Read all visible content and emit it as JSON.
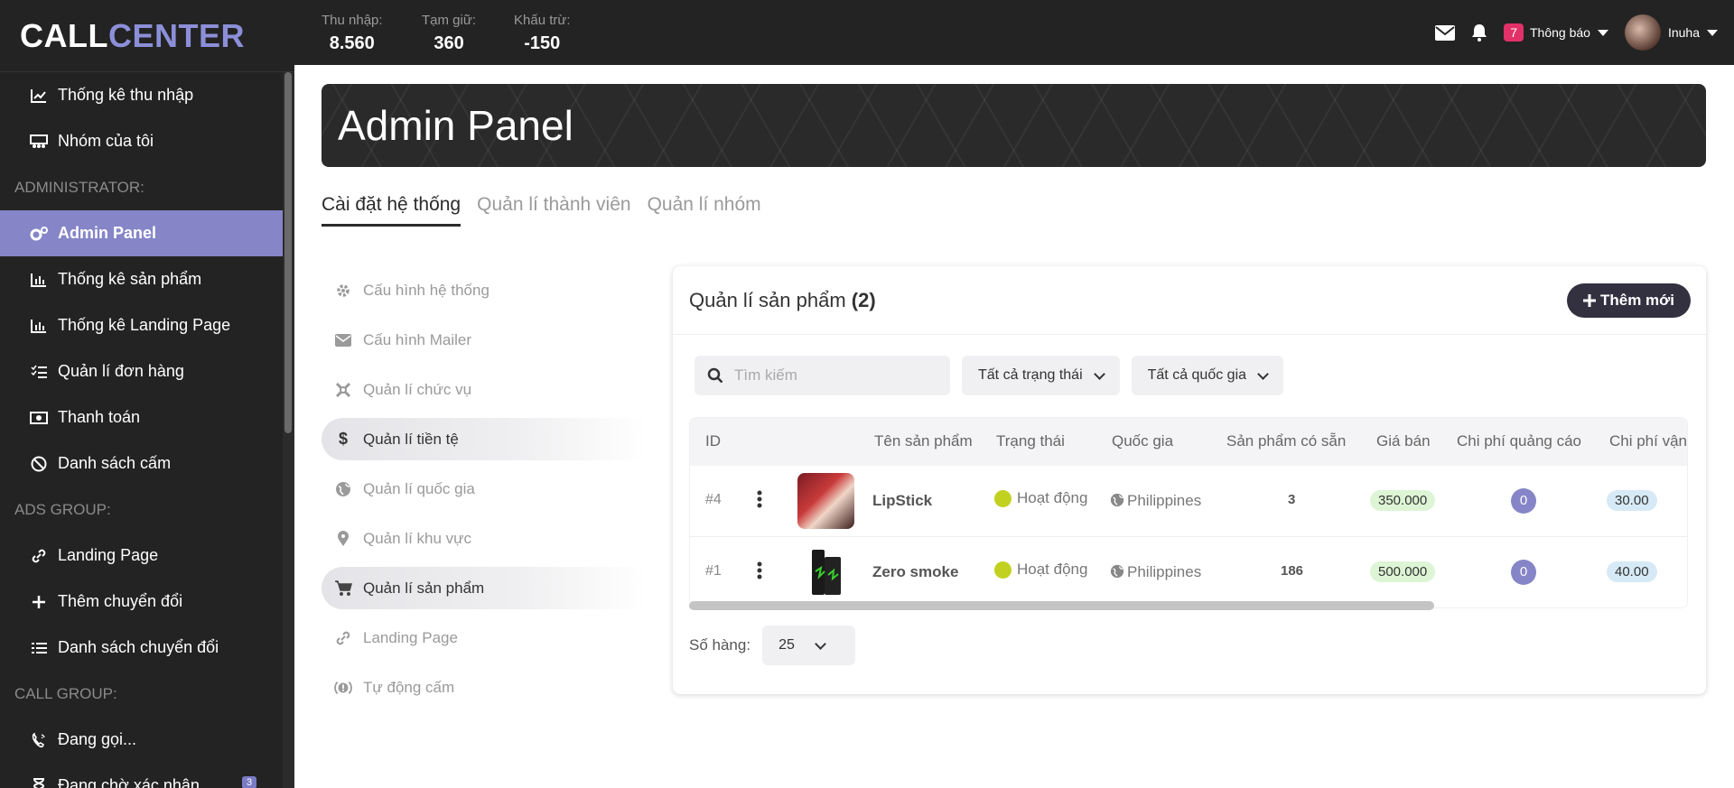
{
  "app": {
    "logo_part1": "CALL",
    "logo_part2": "CENTER",
    "logo_color": "#8c8fd8"
  },
  "topbar": {
    "stats": [
      {
        "label": "Thu nhập:",
        "value": "8.560"
      },
      {
        "label": "Tạm giữ:",
        "value": "360"
      },
      {
        "label": "Khấu trừ:",
        "value": "-150"
      }
    ],
    "notification_count": "7",
    "notification_label": "Thông báo",
    "user_name": "Inuha"
  },
  "sidebar": {
    "items_top": [
      {
        "label": "Thống kê thu nhập",
        "icon": "chart-line-icon"
      },
      {
        "label": "Nhóm của tôi",
        "icon": "group-icon"
      }
    ],
    "admin_title": "ADMINISTRATOR:",
    "admin_items": [
      {
        "label": "Admin Panel",
        "icon": "gears-icon",
        "active": true
      },
      {
        "label": "Thống kê sản phẩm",
        "icon": "bar-chart-icon"
      },
      {
        "label": "Thống kê Landing Page",
        "icon": "bar-chart-icon"
      },
      {
        "label": "Quản lí đơn hàng",
        "icon": "list-check-icon"
      },
      {
        "label": "Thanh toán",
        "icon": "money-icon"
      },
      {
        "label": "Danh sách cấm",
        "icon": "ban-icon"
      }
    ],
    "ads_title": "ADS GROUP:",
    "ads_items": [
      {
        "label": "Landing Page",
        "icon": "link-icon"
      },
      {
        "label": "Thêm chuyển đổi",
        "icon": "plus-icon"
      },
      {
        "label": "Danh sách chuyển đổi",
        "icon": "list-icon"
      }
    ],
    "call_title": "CALL GROUP:",
    "call_items": [
      {
        "label": "Đang gọi...",
        "icon": "phone-volume-icon"
      },
      {
        "label": "Đang chờ xác nhận",
        "icon": "hourglass-icon",
        "badge": "3"
      }
    ]
  },
  "banner": {
    "title": "Admin Panel"
  },
  "tabs": [
    {
      "label": "Cài đặt hệ thống",
      "active": true
    },
    {
      "label": "Quản lí thành viên"
    },
    {
      "label": "Quản lí nhóm"
    }
  ],
  "settings_nav": [
    {
      "label": "Cấu hình hệ thống",
      "icon": "gear-icon"
    },
    {
      "label": "Cấu hình Mailer",
      "icon": "envelope-icon"
    },
    {
      "label": "Quản lí chức vụ",
      "icon": "role-icon"
    },
    {
      "label": "Quản lí tiền tệ",
      "icon": "dollar-icon",
      "active": true
    },
    {
      "label": "Quản lí quốc gia",
      "icon": "globe-icon"
    },
    {
      "label": "Quản lí khu vực",
      "icon": "map-pin-icon"
    },
    {
      "label": "Quản lí sản phẩm",
      "icon": "cart-icon",
      "active": true
    },
    {
      "label": "Landing Page",
      "icon": "link-icon"
    },
    {
      "label": "Tự động cấm",
      "icon": "auto-ban-icon"
    }
  ],
  "card": {
    "title": "Quản lí sản phẩm",
    "count": "(2)",
    "add_button": "Thêm mới",
    "search_placeholder": "Tìm kiếm",
    "filter_status": "Tất cả trạng thái",
    "filter_country": "Tất cả quốc gia",
    "columns": [
      "ID",
      "Tên sản phẩm",
      "Trạng thái",
      "Quốc gia",
      "Sản phẩm có sẵn",
      "Giá bán",
      "Chi phí quảng cáo",
      "Chi phí vận"
    ],
    "rows": [
      {
        "id": "#4",
        "name": "LipStick",
        "status": "Hoạt động",
        "country": "Philippines",
        "stock": "3",
        "price": "350.000",
        "ad_cost": "0",
        "ship_cost": "30.00"
      },
      {
        "id": "#1",
        "name": "Zero smoke",
        "status": "Hoạt động",
        "country": "Philippines",
        "stock": "186",
        "price": "500.000",
        "ad_cost": "0",
        "ship_cost": "40.00"
      }
    ],
    "rows_per_page_label": "Số hàng:",
    "rows_per_page_value": "25"
  }
}
